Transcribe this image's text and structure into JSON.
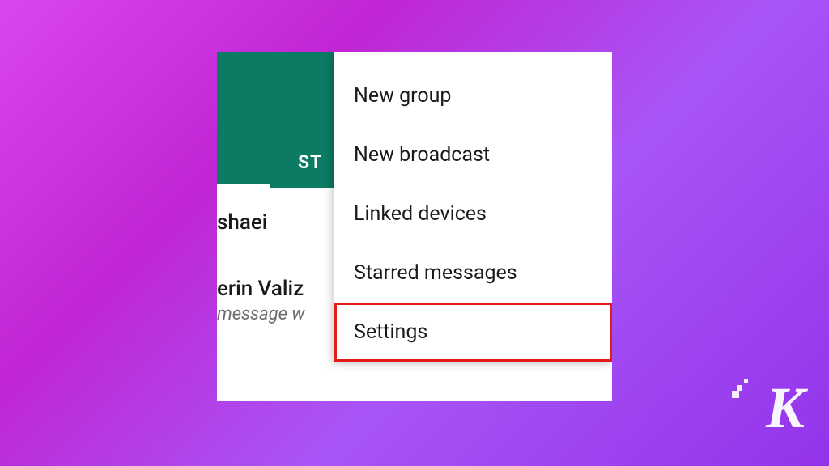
{
  "header": {
    "visible_tab_fragment": "ST"
  },
  "chats": [
    {
      "name_fragment": "shaei"
    },
    {
      "name_fragment": "erin Valiz",
      "preview_fragment": "message w"
    }
  ],
  "menu": {
    "items": [
      {
        "label": "New group",
        "highlighted": false
      },
      {
        "label": "New broadcast",
        "highlighted": false
      },
      {
        "label": "Linked devices",
        "highlighted": false
      },
      {
        "label": "Starred messages",
        "highlighted": false
      },
      {
        "label": "Settings",
        "highlighted": true
      }
    ]
  },
  "watermark": {
    "letter": "K"
  }
}
